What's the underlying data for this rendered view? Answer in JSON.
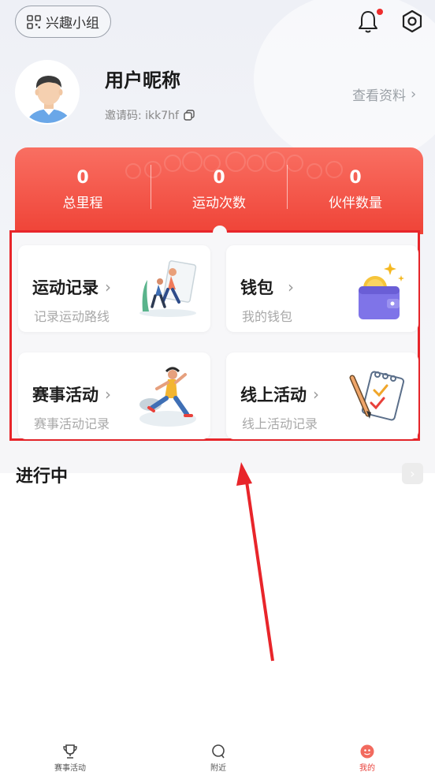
{
  "header": {
    "group_button_label": "兴趣小组",
    "icons": [
      "qr-icon",
      "bell-icon",
      "settings-icon"
    ],
    "has_notification_dot": true
  },
  "profile": {
    "nickname": "用户昵称",
    "invite_code": "邀请码: ikk7hf",
    "view_profile_label": "查看资料"
  },
  "stats": [
    {
      "value": "0",
      "label": "总里程"
    },
    {
      "value": "0",
      "label": "运动次数"
    },
    {
      "value": "0",
      "label": "伙伴数量"
    }
  ],
  "cards": [
    {
      "title": "运动记录",
      "subtitle": "记录运动路线"
    },
    {
      "title": "钱包",
      "subtitle": "我的钱包"
    },
    {
      "title": "赛事活动",
      "subtitle": "赛事活动记录"
    },
    {
      "title": "线上活动",
      "subtitle": "线上活动记录"
    }
  ],
  "ongoing": {
    "title": "进行中"
  },
  "tabbar": {
    "items": [
      {
        "label": "赛事活动",
        "icon": "trophy-icon"
      },
      {
        "label": "附近",
        "icon": "nearby-icon"
      },
      {
        "label": "我的",
        "icon": "profile-icon"
      }
    ],
    "active_index": 2
  },
  "colors": {
    "accent_red": "#ef4337",
    "highlight_border": "#e8252a"
  }
}
